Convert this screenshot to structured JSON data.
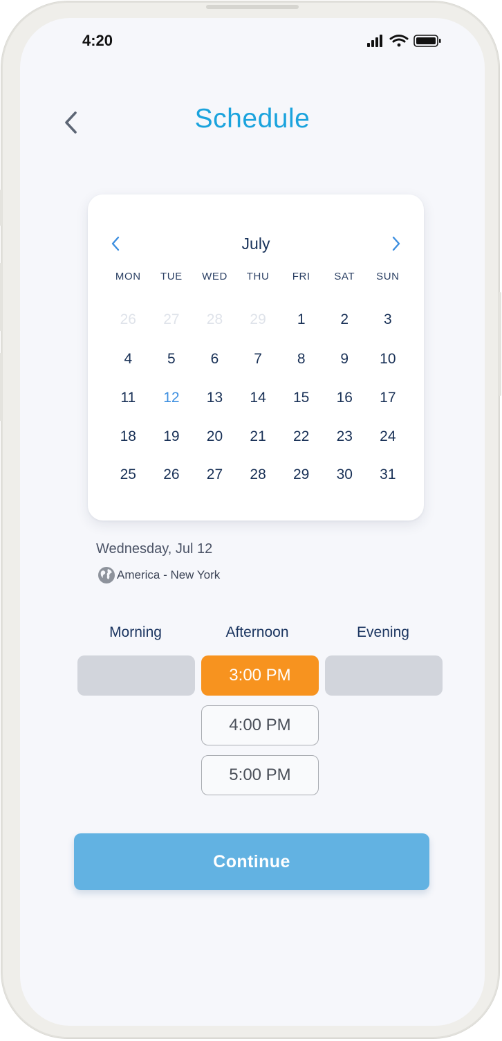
{
  "status_bar": {
    "time": "4:20"
  },
  "header": {
    "title": "Schedule"
  },
  "calendar": {
    "month": "July",
    "weekdays": [
      "MON",
      "TUE",
      "WED",
      "THU",
      "FRI",
      "SAT",
      "SUN"
    ],
    "days": [
      {
        "label": "26",
        "muted": true
      },
      {
        "label": "27",
        "muted": true
      },
      {
        "label": "28",
        "muted": true
      },
      {
        "label": "29",
        "muted": true
      },
      {
        "label": "1"
      },
      {
        "label": "2"
      },
      {
        "label": "3"
      },
      {
        "label": "4"
      },
      {
        "label": "5"
      },
      {
        "label": "6"
      },
      {
        "label": "7"
      },
      {
        "label": "8"
      },
      {
        "label": "9"
      },
      {
        "label": "10"
      },
      {
        "label": "11"
      },
      {
        "label": "12",
        "today": true
      },
      {
        "label": "13"
      },
      {
        "label": "14"
      },
      {
        "label": "15"
      },
      {
        "label": "16"
      },
      {
        "label": "17"
      },
      {
        "label": "18"
      },
      {
        "label": "19"
      },
      {
        "label": "20"
      },
      {
        "label": "21"
      },
      {
        "label": "22"
      },
      {
        "label": "23"
      },
      {
        "label": "24"
      },
      {
        "label": "25"
      },
      {
        "label": "26"
      },
      {
        "label": "27"
      },
      {
        "label": "28"
      },
      {
        "label": "29"
      },
      {
        "label": "30"
      },
      {
        "label": "31"
      }
    ]
  },
  "selection": {
    "date_label": "Wednesday, Jul 12",
    "timezone": "America - New York"
  },
  "slots": {
    "morning": {
      "label": "Morning"
    },
    "afternoon": {
      "label": "Afternoon",
      "times": [
        "3:00 PM",
        "4:00 PM",
        "5:00 PM"
      ]
    },
    "evening": {
      "label": "Evening"
    }
  },
  "actions": {
    "continue_label": "Continue"
  },
  "colors": {
    "accent": "#1aa3dd",
    "selected_slot": "#f7931f",
    "continue_button": "#62b2e2",
    "today": "#3d8fe0"
  }
}
